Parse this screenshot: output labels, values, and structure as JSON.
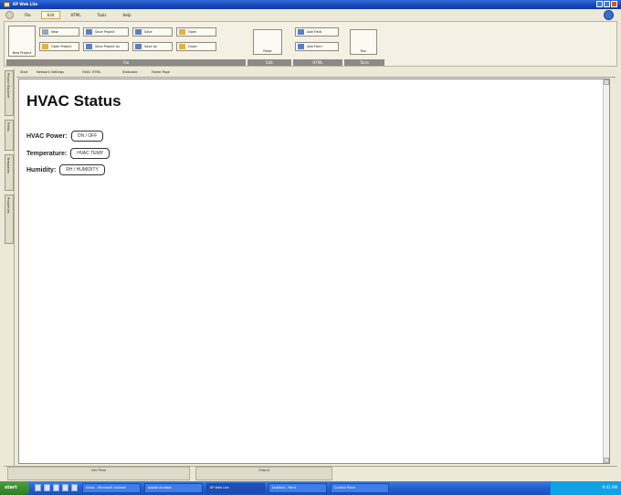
{
  "window": {
    "title": "KP Web Lite"
  },
  "menu": {
    "tabs": [
      {
        "label": "File"
      },
      {
        "label": "Edit"
      },
      {
        "label": "HTML"
      },
      {
        "label": "Tools"
      },
      {
        "label": "Help"
      }
    ]
  },
  "ribbon": {
    "groups": [
      {
        "label": "File",
        "big_button": "New Project",
        "small_buttons": [
          "New",
          "Open Project",
          "Save Project",
          "Save Project As",
          "Save",
          "Save As",
          "Open",
          "Close"
        ]
      },
      {
        "label": "Edit",
        "big_button": "Paste",
        "small_buttons": [
          "Cut",
          "Copy"
        ]
      },
      {
        "label": "HTML",
        "big_button": "Page",
        "small_buttons": [
          "Add Field",
          "Add Form"
        ]
      },
      {
        "label": "Tools",
        "big_button": "Run"
      }
    ]
  },
  "side_tabs": [
    {
      "label": "Project Explorer"
    },
    {
      "label": "Fields"
    },
    {
      "label": "Templates"
    },
    {
      "label": "Properties"
    }
  ],
  "doc_tabs": [
    {
      "label": "Start"
    },
    {
      "label": "Network Settings"
    },
    {
      "label": "HVAC HTML"
    },
    {
      "label": "Statusbar"
    },
    {
      "label": "Home Page"
    }
  ],
  "page": {
    "title": "HVAC Status",
    "rows": [
      {
        "label": "HVAC Power:",
        "value": "ON / OFF"
      },
      {
        "label": "Temperature:",
        "value": "HVAC TEMP"
      },
      {
        "label": "Humidity:",
        "value": "RH / HUMIDITY"
      }
    ]
  },
  "bottom_panels": [
    {
      "label": "Info Pane"
    },
    {
      "label": "Output"
    }
  ],
  "taskbar": {
    "start_label": "start",
    "tasks": [
      {
        "label": "Inbox - Microsoft Outlook"
      },
      {
        "label": "Adobe Acrobat"
      },
      {
        "label": "KP Web Lite"
      },
      {
        "label": "Untitled - Paint"
      },
      {
        "label": "Control Panel"
      }
    ],
    "clock": "9:41 AM"
  },
  "colors": {
    "titlebar": "#1846b9",
    "taskbar": "#245dcd",
    "start_button": "#2f7d22",
    "ribbon_group_label": "#8a8a86"
  }
}
